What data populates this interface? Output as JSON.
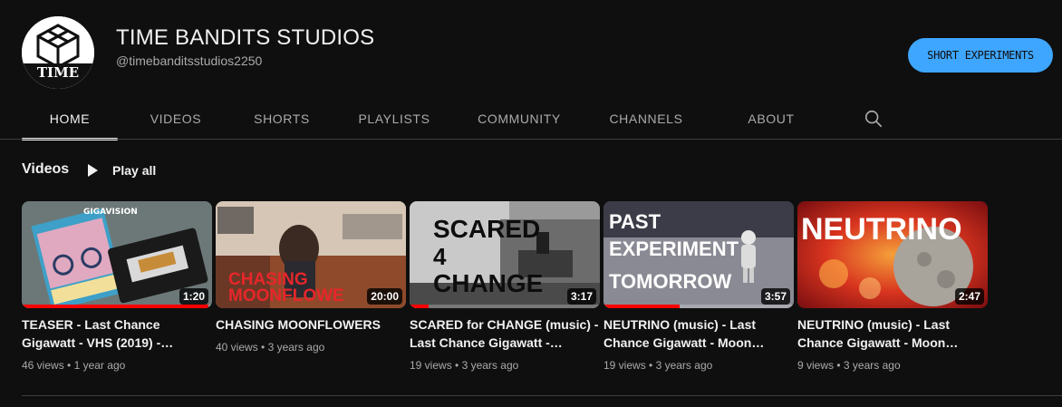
{
  "channel": {
    "name": "TIME BANDITS STUDIOS",
    "handle": "@timebanditsstudios2250",
    "avatar_text": "TIME",
    "avatar_icon": "cube-logo-icon",
    "header_link": "SHORT EXPERIMENTS"
  },
  "tabs": [
    {
      "label": "HOME",
      "active": true
    },
    {
      "label": "VIDEOS",
      "active": false
    },
    {
      "label": "SHORTS",
      "active": false
    },
    {
      "label": "PLAYLISTS",
      "active": false
    },
    {
      "label": "COMMUNITY",
      "active": false
    },
    {
      "label": "CHANNELS",
      "active": false
    },
    {
      "label": "ABOUT",
      "active": false
    }
  ],
  "search_icon": "search-icon",
  "section": {
    "title": "Videos",
    "play_all": "Play all",
    "play_icon": "play-icon"
  },
  "videos": [
    {
      "title": "TEASER - Last Chance Gigawatt - VHS (2019) -…",
      "views": "46 views",
      "age": "1 year ago",
      "duration": "1:20",
      "watched": 0.98,
      "thumb_text": [
        "GIGAVISION"
      ]
    },
    {
      "title": "CHASING MOONFLOWERS",
      "views": "40 views",
      "age": "3 years ago",
      "duration": "20:00",
      "watched": 0.0,
      "thumb_text": [
        "CHASING",
        "MOONFLOWE"
      ]
    },
    {
      "title": "SCARED for CHANGE (music) - Last Chance Gigawatt -…",
      "views": "19 views",
      "age": "3 years ago",
      "duration": "3:17",
      "watched": 0.1,
      "thumb_text": [
        "SCARED",
        "4",
        "CHANGE"
      ]
    },
    {
      "title": "NEUTRINO (music) - Last Chance Gigawatt - Moon…",
      "views": "19 views",
      "age": "3 years ago",
      "duration": "3:57",
      "watched": 0.4,
      "thumb_text": [
        "PAST",
        "EXPERIMENT",
        "TOMORROW"
      ]
    },
    {
      "title": "NEUTRINO (music) - Last Chance Gigawatt - Moon…",
      "views": "9 views",
      "age": "3 years ago",
      "duration": "2:47",
      "watched": 0.0,
      "thumb_text": [
        "NEUTRINO"
      ]
    }
  ],
  "meta_separator": "•",
  "colors": {
    "background": "#0f0f0f",
    "accent_link": "#3ea6ff",
    "progress": "#ff0000",
    "secondary_text": "#aaaaaa"
  }
}
